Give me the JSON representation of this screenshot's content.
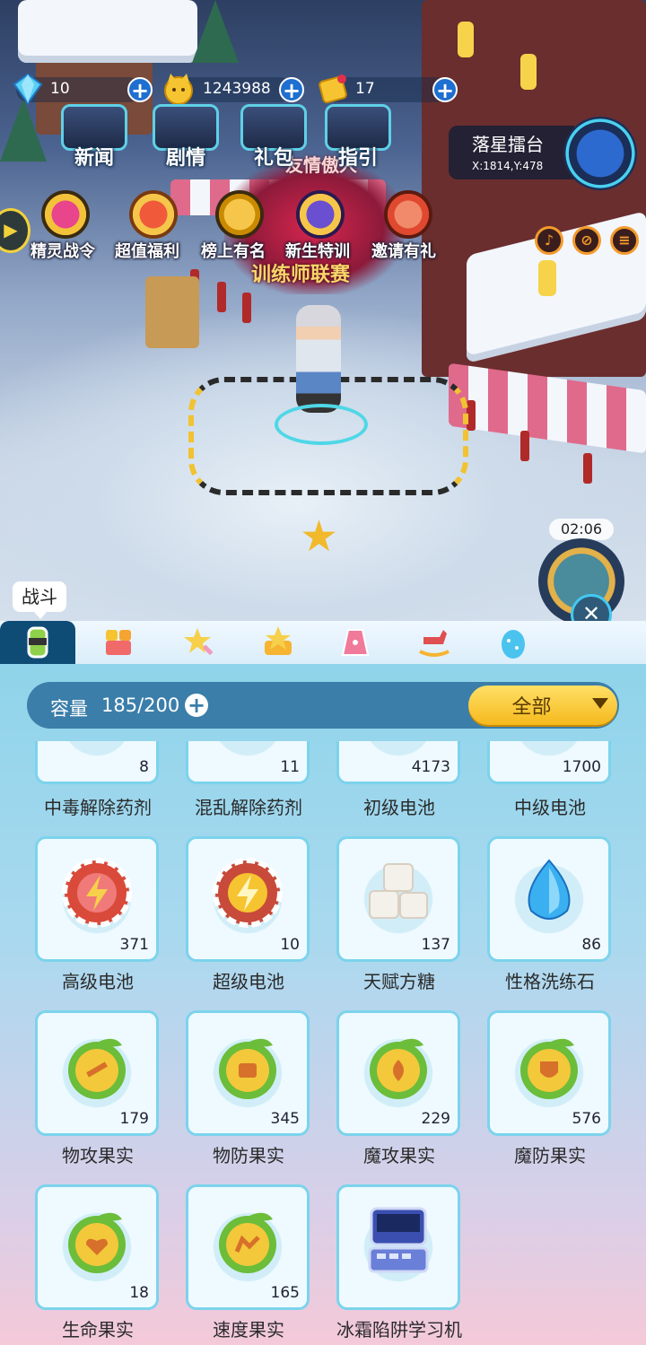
{
  "currencies": [
    {
      "icon": "diamond-icon",
      "value": "10"
    },
    {
      "icon": "cat-coin-icon",
      "value": "1243988"
    },
    {
      "icon": "ticket-icon",
      "value": "17"
    }
  ],
  "top_menu": [
    "新闻",
    "剧情",
    "礼包",
    "指引"
  ],
  "activities": [
    "精灵战令",
    "超值福利",
    "榜上有名",
    "新生特训",
    "邀请有礼"
  ],
  "arena": {
    "title": "落星擂台",
    "coord": "X:1814,Y:478"
  },
  "event": {
    "top_text": "友情傲人",
    "title": "训练师联赛"
  },
  "timer": "02:06",
  "tabs": {
    "active_tip": "战斗"
  },
  "bag": {
    "capacity_label": "容量",
    "capacity_value": "185/200",
    "filter": "全部",
    "items": [
      {
        "name": "中毒解除药剂",
        "count": "8"
      },
      {
        "name": "混乱解除药剂",
        "count": "11"
      },
      {
        "name": "初级电池",
        "count": "4173"
      },
      {
        "name": "中级电池",
        "count": "1700"
      },
      {
        "name": "高级电池",
        "count": "371"
      },
      {
        "name": "超级电池",
        "count": "10"
      },
      {
        "name": "天赋方糖",
        "count": "137"
      },
      {
        "name": "性格洗练石",
        "count": "86"
      },
      {
        "name": "物攻果实",
        "count": "179"
      },
      {
        "name": "物防果实",
        "count": "345"
      },
      {
        "name": "魔攻果实",
        "count": "229"
      },
      {
        "name": "魔防果实",
        "count": "576"
      },
      {
        "name": "生命果实",
        "count": "18"
      },
      {
        "name": "速度果实",
        "count": "165"
      },
      {
        "name": "冰霜陷阱学习机",
        "count": ""
      }
    ]
  },
  "colors": {
    "accent": "#3b7eaa",
    "filter": "#f5b91d",
    "cell_border": "#7cd3ec"
  }
}
